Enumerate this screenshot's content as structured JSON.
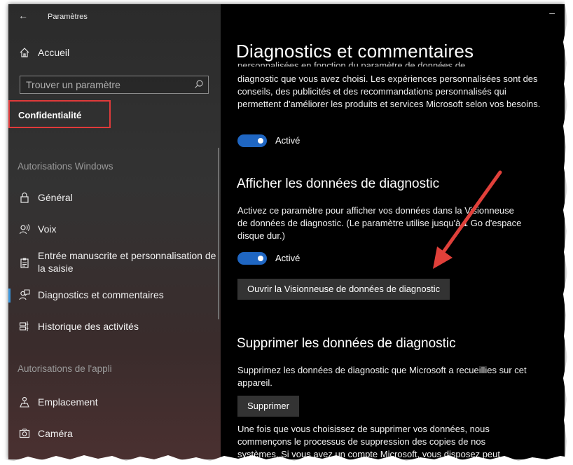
{
  "window": {
    "title": "Paramètres",
    "back_icon": "back-arrow-icon",
    "minimize_glyph": "–"
  },
  "sidebar": {
    "home": {
      "label": "Accueil",
      "icon": "home-icon"
    },
    "search": {
      "placeholder": "Trouver un paramètre",
      "icon": "search-icon"
    },
    "current_section": "Confidentialité",
    "highlight_color": "#e03a3a",
    "groups": [
      {
        "heading": "Autorisations Windows",
        "items": [
          {
            "label": "Général",
            "icon": "lock-icon"
          },
          {
            "label": "Voix",
            "icon": "voice-icon"
          },
          {
            "label": "Entrée manuscrite et personnalisation de la saisie",
            "icon": "clipboard-icon"
          },
          {
            "label": "Diagnostics et commentaires",
            "icon": "feedback-icon",
            "selected": true
          },
          {
            "label": "Historique des activités",
            "icon": "timeline-icon"
          }
        ]
      },
      {
        "heading": "Autorisations de l'appli",
        "items": [
          {
            "label": "Emplacement",
            "icon": "location-icon"
          },
          {
            "label": "Caméra",
            "icon": "camera-icon"
          }
        ]
      }
    ]
  },
  "content": {
    "page_title": "Diagnostics et commentaires",
    "cut_line": "personnalisées en fonction du paramètre de données de",
    "tailored_paragraph": "diagnostic que vous avez choisi. Les expériences personnalisées sont des conseils, des publicités et des recommandations personnalisés qui permettent d'améliorer les produits et services Microsoft selon vos besoins.",
    "toggle1_label": "Activé",
    "view_section": {
      "heading": "Afficher les données de diagnostic",
      "paragraph": "Activez ce paramètre pour afficher vos données dans la Visionneuse de données de diagnostic. (Le paramètre utilise jusqu'à 1 Go d'espace disque dur.)",
      "toggle_label": "Activé",
      "button": "Ouvrir la Visionneuse de données de diagnostic"
    },
    "delete_section": {
      "heading": "Supprimer les données de diagnostic",
      "paragraph": "Supprimez les données de diagnostic que Microsoft a recueillies sur cet appareil.",
      "button": "Supprimer",
      "after_paragraph": "Une fois que vous choisissez de supprimer vos données, nous commençons le processus de suppression des copies de nos systèmes. Si vous avez un compte Microsoft, vous disposez peut"
    },
    "toggle_color": "#1f66c2",
    "annotation_arrow_color": "#e0403a"
  }
}
